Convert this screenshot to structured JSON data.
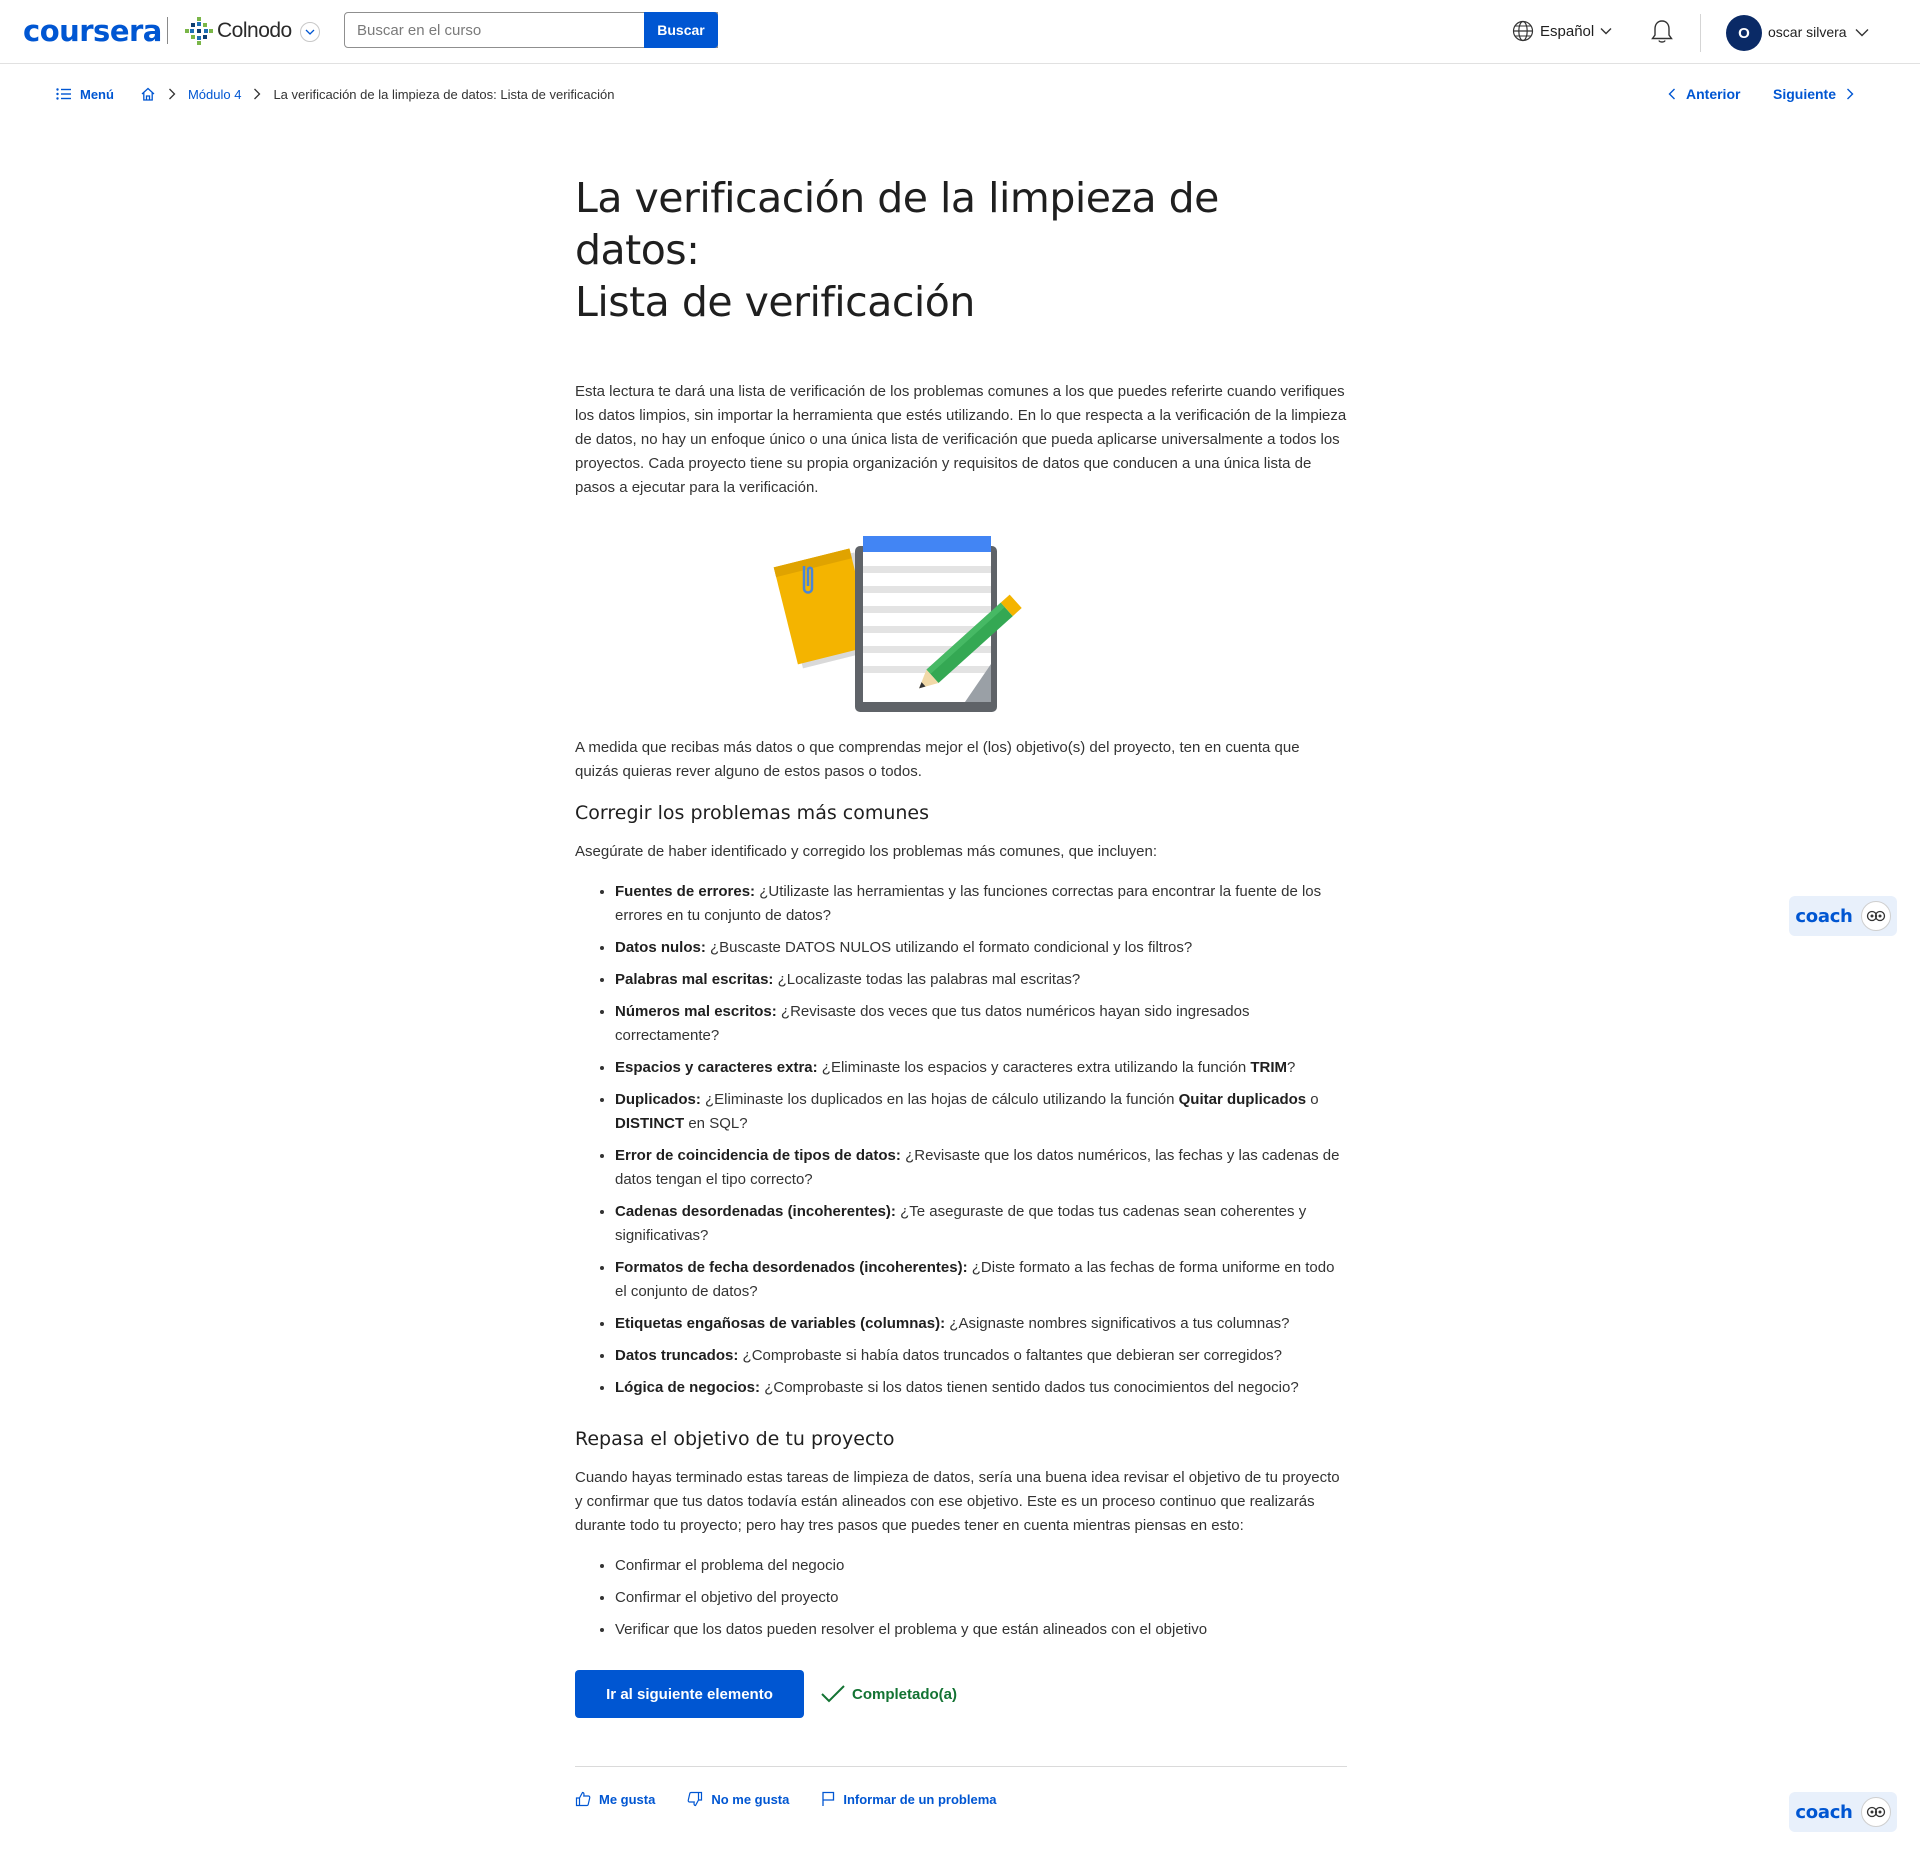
{
  "header": {
    "logo": "coursera",
    "partner": "Colnodo",
    "search_placeholder": "Buscar en el curso",
    "search_button": "Buscar",
    "language": "Español",
    "avatar_initial": "O",
    "user_name": "oscar silvera"
  },
  "breadcrumb": {
    "menu": "Menú",
    "module": "Módulo 4",
    "current": "La verificación de la limpieza de datos: Lista de verificación",
    "prev": "Anterior",
    "next": "Siguiente"
  },
  "article": {
    "title_line1": "La verificación de la limpieza de datos:",
    "title_line2": "Lista de verificación",
    "intro": "Esta lectura te dará una lista de verificación de los problemas comunes a los que puedes referirte cuando verifiques los datos limpios, sin importar la herramienta que estés utilizando. En lo que respecta a la verificación de la limpieza de datos, no hay un enfoque único o una única lista de verificación que pueda aplicarse universalmente a todos los proyectos. Cada proyecto tiene su propia organización y requisitos de datos que conducen a una única lista de pasos a ejecutar para la verificación.",
    "after_image": "A medida que recibas más datos o que comprendas mejor el (los) objetivo(s) del proyecto, ten en cuenta que quizás quieras rever alguno de estos pasos o todos.",
    "section1_title": "Corregir los problemas más comunes",
    "section1_lead": "Asegúrate de haber identificado y corregido los problemas más comunes, que incluyen:",
    "items": [
      {
        "term": "Fuentes de errores:",
        "text": " ¿Utilizaste las herramientas y las funciones correctas para encontrar la fuente de los errores en tu conjunto de datos?"
      },
      {
        "term": "Datos nulos:",
        "text": " ¿Buscaste DATOS NULOS utilizando el formato condicional y los filtros?"
      },
      {
        "term": "Palabras mal escritas:",
        "text": " ¿Localizaste todas las palabras mal escritas?"
      },
      {
        "term": "Números mal escritos:",
        "text": " ¿Revisaste dos veces que tus datos numéricos hayan sido ingresados correctamente?"
      },
      {
        "term": "Espacios y caracteres extra:",
        "text": " ¿Eliminaste los espacios y caracteres extra utilizando la función ",
        "bold2": "TRIM",
        "text2": "?"
      },
      {
        "term": "Duplicados:",
        "text": " ¿Eliminaste los duplicados en las hojas de cálculo utilizando la función ",
        "bold2": "Quitar duplicados",
        "text2": " o ",
        "bold3": "DISTINCT",
        "text3": " en SQL?"
      },
      {
        "term": "Error de coincidencia de tipos de datos:",
        "text": " ¿Revisaste que los datos numéricos, las fechas y las cadenas de datos tengan el tipo correcto?"
      },
      {
        "term": "Cadenas desordenadas (incoherentes):",
        "text": " ¿Te aseguraste de que todas tus cadenas sean coherentes y significativas?"
      },
      {
        "term": "Formatos de fecha desordenados (incoherentes):",
        "text": " ¿Diste formato a las fechas de forma uniforme en todo el conjunto de datos?"
      },
      {
        "term": "Etiquetas engañosas de variables (columnas):",
        "text": " ¿Asignaste nombres significativos a tus columnas?"
      },
      {
        "term": "Datos truncados:",
        "text": " ¿Comprobaste si había datos truncados o faltantes que debieran ser corregidos?"
      },
      {
        "term": "Lógica de negocios:",
        "text": " ¿Comprobaste si los datos tienen sentido dados tus conocimientos del negocio?"
      }
    ],
    "section2_title": "Repasa el objetivo de tu proyecto",
    "section2_text": "Cuando hayas terminado estas tareas de limpieza de datos, sería una buena idea revisar el objetivo de tu proyecto y confirmar que tus datos todavía están alineados con ese objetivo. Este es un proceso continuo que realizarás durante todo tu proyecto; pero hay tres pasos que puedes tener en cuenta mientras piensas en esto:",
    "steps": [
      "Confirmar el problema del negocio",
      "Confirmar el objetivo del proyecto",
      "Verificar que los datos pueden resolver el problema y que están alineados con el objetivo"
    ],
    "next_button": "Ir al siguiente elemento",
    "completed": "Completado(a)",
    "like": "Me gusta",
    "dislike": "No me gusta",
    "report": "Informar de un problema"
  },
  "coach": {
    "label": "coach"
  },
  "colors": {
    "brand": "#0056d2",
    "success": "#137333"
  },
  "icons": [
    "globe-icon",
    "chevron-down-icon",
    "bell-icon",
    "menu-list-icon",
    "home-icon",
    "chevron-right-icon",
    "chevron-left-icon",
    "checkmark-icon",
    "thumbs-up-icon",
    "thumbs-down-icon",
    "flag-icon",
    "coach-eyes-icon"
  ]
}
